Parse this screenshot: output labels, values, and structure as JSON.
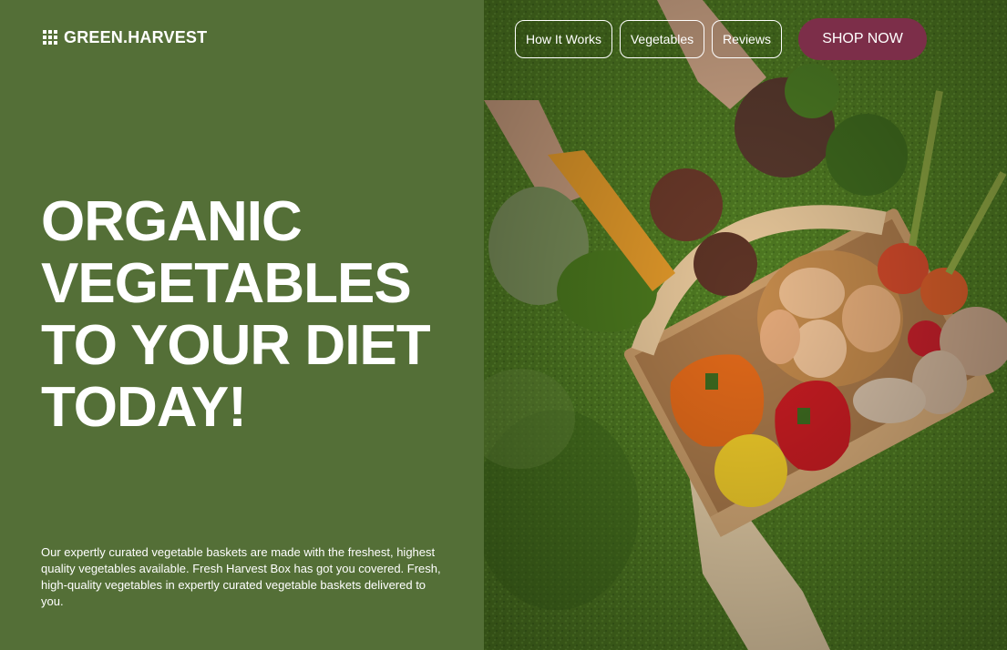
{
  "brand": {
    "name": "GREEN.HARVEST",
    "icon": "grid-icon"
  },
  "nav": {
    "links": [
      "How It Works",
      "Vegetables",
      "Reviews"
    ],
    "cta": "SHOP NOW"
  },
  "hero": {
    "title_lines": [
      "ORGANIC",
      "VEGETABLES",
      "TO YOUR DIET",
      "TODAY!"
    ],
    "description": "Our expertly curated vegetable baskets are made with the freshest, highest quality vegetables available. Fresh Harvest Box has got you covered. Fresh, high-quality vegetables in expertly curated vegetable baskets delivered to you."
  },
  "colors": {
    "panel_green": "#546f37",
    "cta_maroon": "#7c2e49",
    "text": "#ffffff"
  }
}
